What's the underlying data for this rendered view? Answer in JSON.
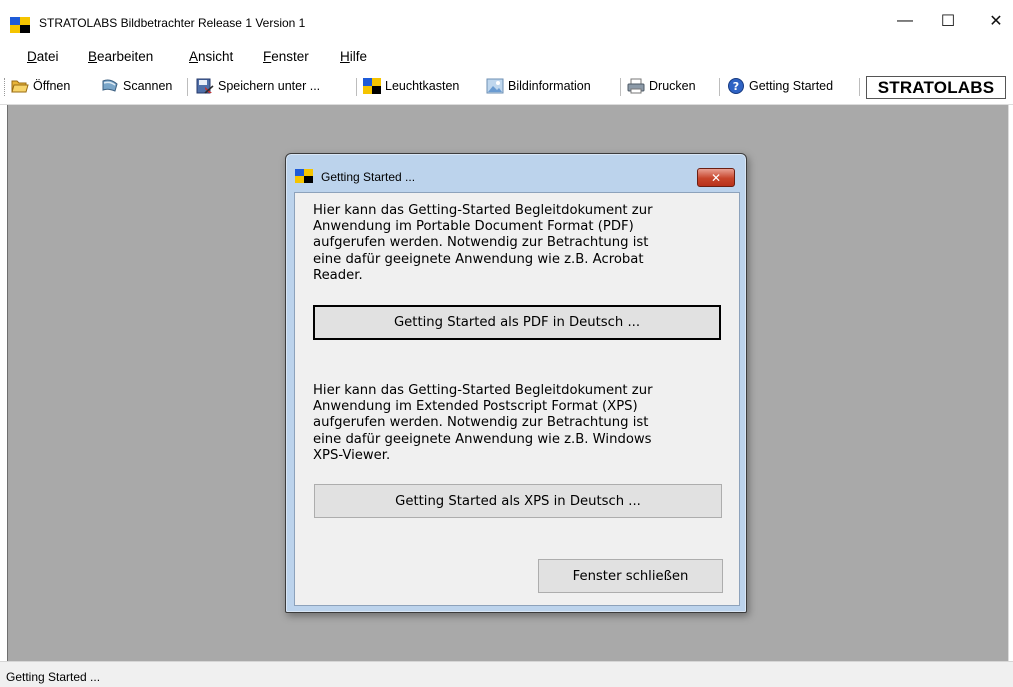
{
  "window": {
    "title": "STRATOLABS Bildbetrachter Release 1 Version 1",
    "minimize_glyph": "—",
    "maximize_glyph": "☐",
    "close_glyph": "✕"
  },
  "menu": {
    "items": [
      {
        "underline": "D",
        "rest": "atei"
      },
      {
        "underline": "B",
        "rest": "earbeiten"
      },
      {
        "underline": "A",
        "rest": "nsicht"
      },
      {
        "underline": "F",
        "rest": "enster"
      },
      {
        "underline": "H",
        "rest": "ilfe"
      }
    ]
  },
  "toolbar": {
    "open_label": "Öffnen",
    "scan_label": "Scannen",
    "save_as_label": "Speichern unter ...",
    "lightbox_label": "Leuchtkasten",
    "image_info_label": "Bildinformation",
    "print_label": "Drucken",
    "getting_started_label": "Getting Started",
    "brand_label": "STRATOLABS"
  },
  "dialog": {
    "title": "Getting Started ...",
    "close_glyph": "✕",
    "pdf_text_lines": [
      "Hier kann das Getting-Started Begleitdokument zur",
      "Anwendung im Portable Document Format (PDF)",
      "aufgerufen werden. Notwendig zur Betrachtung ist",
      "eine dafür geeignete Anwendung wie z.B. Acrobat",
      "Reader."
    ],
    "pdf_button": "Getting Started als PDF in Deutsch ...",
    "xps_text_lines": [
      "Hier kann das Getting-Started Begleitdokument zur",
      "Anwendung im Extended Postscript Format (XPS)",
      "aufgerufen werden. Notwendig zur Betrachtung ist",
      "eine dafür geeignete Anwendung wie z.B. Windows",
      "XPS-Viewer."
    ],
    "xps_button": "Getting Started als XPS in Deutsch ...",
    "close_button": "Fenster schließen"
  },
  "statusbar": {
    "text": "Getting Started ..."
  },
  "colors": {
    "logo_blue": "#1e5bd8",
    "logo_yellow": "#f5c400",
    "logo_black": "#000000",
    "workspace": "#a9a9a9",
    "dialog_frame": "#bcd3ec",
    "dialog_close": "#c7452b"
  },
  "icons": {
    "open": "folder-open-icon",
    "scan": "scanner-icon",
    "save_as": "save-as-icon",
    "lightbox": "lightbox-icon",
    "image_info": "image-info-icon",
    "print": "printer-icon",
    "help": "help-icon"
  }
}
